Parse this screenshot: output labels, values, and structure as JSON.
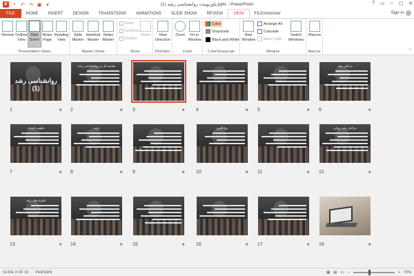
{
  "window": {
    "title": "پاورپوینت روانشناسی رشد (1).pptx - PowerPoint",
    "controls": [
      "?",
      "▭",
      "–",
      "▢",
      "✕"
    ]
  },
  "tabs": [
    "FILE",
    "HOME",
    "INSERT",
    "DESIGN",
    "TRANSITIONS",
    "ANIMATIONS",
    "SLIDE SHOW",
    "REVIEW",
    "VIEW",
    "FILEminimizer"
  ],
  "signin": "Sign in",
  "ribbon": {
    "presentation_views": {
      "label": "Presentation Views",
      "normal": "Normal",
      "outline": "Outline View",
      "slide_sorter": "Slide Sorter",
      "notes_page": "Notes Page",
      "reading_view": "Reading View"
    },
    "master_views": {
      "label": "Master Views",
      "slide_master": "Slide Master",
      "handout_master": "Handout Master",
      "notes_master": "Notes Master"
    },
    "show": {
      "label": "Show",
      "ruler": "Ruler",
      "gridlines": "Gridlines",
      "guides": "Guides",
      "notes": "Notes"
    },
    "direction": {
      "label": "Direction",
      "view_direction": "View Direction"
    },
    "zoom": {
      "label": "Zoom",
      "zoom": "Zoom",
      "fit": "Fit to Window"
    },
    "color": {
      "label": "Color/Grayscale",
      "color": "Color",
      "grayscale": "Grayscale",
      "bw": "Black and White"
    },
    "window": {
      "label": "Window",
      "new_window": "New Window",
      "arrange_all": "Arrange All",
      "cascade": "Cascade",
      "move_split": "Move Split",
      "switch": "Switch Windows"
    },
    "macros": {
      "label": "Macros",
      "macros": "Macros"
    }
  },
  "slides": [
    {
      "n": "1",
      "title": "روانشناسی رشد (1)"
    },
    {
      "n": "2",
      "title": "مقدمه ای بر روانشناسی رشد",
      "lines": [
        "• نظریه های شناختی",
        "• نظریه های یادگیری",
        "• نظریه های روانکاوی"
      ]
    },
    {
      "n": "3",
      "title": ""
    },
    {
      "n": "4",
      "title": ""
    },
    {
      "n": "5",
      "title": ""
    },
    {
      "n": "6",
      "title": "مراحل رشد",
      "lines": [
        "• جنین",
        "• نوزادی",
        "• کودکی اول",
        "• کودکی دوم"
      ]
    },
    {
      "n": "7",
      "title": "ماهیت انسان"
    },
    {
      "n": "8",
      "title": "رشد"
    },
    {
      "n": "9",
      "title": ""
    },
    {
      "n": "10",
      "title": "روانکاوی"
    },
    {
      "n": "11",
      "title": ""
    },
    {
      "n": "12",
      "title": "مراحل رشد روانی"
    },
    {
      "n": "13",
      "title": "نظریه های رشد"
    },
    {
      "n": "14",
      "title": ""
    },
    {
      "n": "15",
      "title": ""
    },
    {
      "n": "16",
      "title": ""
    },
    {
      "n": "17",
      "title": ""
    },
    {
      "n": "18",
      "title": ""
    }
  ],
  "status": {
    "slide": "SLIDE 3 OF 18",
    "language": "PERSIAN",
    "zoom": "70%"
  }
}
